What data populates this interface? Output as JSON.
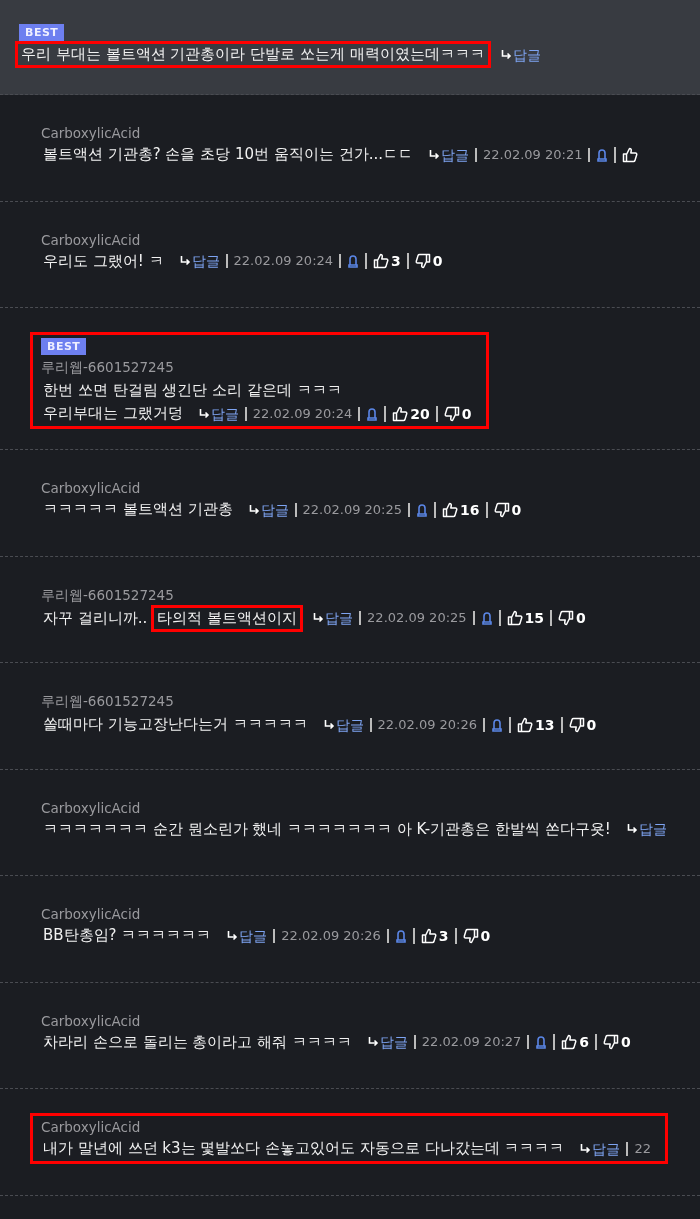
{
  "comments": [
    {
      "kind": "top",
      "badge": "BEST",
      "highlighted": false,
      "lines": [
        [
          {
            "text": "우리 부대는 볼트액션 기관총이라 단발로 쏘는게 매력이였는데ㅋㅋㅋ",
            "highlighted": true
          }
        ]
      ],
      "meta": [
        {
          "kind": "reply",
          "text": "답글"
        }
      ]
    },
    {
      "kind": "reply",
      "author": "CarboxylicAcid",
      "highlighted": false,
      "lines": [
        [
          {
            "text": "볼트액션 기관총? 손을 초당 10번 움직이는 건가...ㄷㄷ",
            "highlighted": false
          }
        ]
      ],
      "meta": [
        {
          "kind": "reply",
          "text": "답글"
        },
        {
          "kind": "date",
          "text": "22.02.09 20:21"
        },
        {
          "kind": "bell"
        },
        {
          "kind": "like"
        }
      ]
    },
    {
      "kind": "reply",
      "author": "CarboxylicAcid",
      "highlighted": false,
      "lines": [
        [
          {
            "text": "우리도 그랬어! ㅋ",
            "highlighted": false
          }
        ]
      ],
      "meta": [
        {
          "kind": "reply",
          "text": "답글"
        },
        {
          "kind": "date",
          "text": "22.02.09 20:24"
        },
        {
          "kind": "bell"
        },
        {
          "kind": "like",
          "count": "3"
        },
        {
          "kind": "dislike",
          "count": "0"
        }
      ]
    },
    {
      "kind": "reply",
      "badge": "BEST",
      "author": "루리웹-6601527245",
      "highlighted": true,
      "lines": [
        [
          {
            "text": "한번 쏘면 탄걸림 생긴단 소리 같은데 ㅋㅋㅋ",
            "highlighted": false
          }
        ],
        [
          {
            "text": "우리부대는 그랬거덩",
            "highlighted": false
          }
        ]
      ],
      "meta": [
        {
          "kind": "reply",
          "text": "답글"
        },
        {
          "kind": "date",
          "text": "22.02.09 20:24"
        },
        {
          "kind": "bell"
        },
        {
          "kind": "like",
          "count": "20"
        },
        {
          "kind": "dislike",
          "count": "0"
        }
      ]
    },
    {
      "kind": "reply",
      "author": "CarboxylicAcid",
      "highlighted": false,
      "lines": [
        [
          {
            "text": "ㅋㅋㅋㅋㅋ 볼트액션 기관총",
            "highlighted": false
          }
        ]
      ],
      "meta": [
        {
          "kind": "reply",
          "text": "답글"
        },
        {
          "kind": "date",
          "text": "22.02.09 20:25"
        },
        {
          "kind": "bell"
        },
        {
          "kind": "like",
          "count": "16"
        },
        {
          "kind": "dislike",
          "count": "0"
        }
      ]
    },
    {
      "kind": "reply",
      "author": "루리웹-6601527245",
      "highlighted": false,
      "lines": [
        [
          {
            "text": "자꾸 걸리니까..",
            "highlighted": false
          },
          {
            "text": "타의적 볼트액션이지",
            "highlighted": true
          }
        ]
      ],
      "meta": [
        {
          "kind": "reply",
          "text": "답글"
        },
        {
          "kind": "date",
          "text": "22.02.09 20:25"
        },
        {
          "kind": "bell"
        },
        {
          "kind": "like",
          "count": "15"
        },
        {
          "kind": "dislike",
          "count": "0"
        }
      ]
    },
    {
      "kind": "reply",
      "author": "루리웹-6601527245",
      "highlighted": false,
      "lines": [
        [
          {
            "text": "쏠때마다 기능고장난다는거 ㅋㅋㅋㅋㅋ",
            "highlighted": false
          }
        ]
      ],
      "meta": [
        {
          "kind": "reply",
          "text": "답글"
        },
        {
          "kind": "date",
          "text": "22.02.09 20:26"
        },
        {
          "kind": "bell"
        },
        {
          "kind": "like",
          "count": "13"
        },
        {
          "kind": "dislike",
          "count": "0"
        }
      ]
    },
    {
      "kind": "reply",
      "author": "CarboxylicAcid",
      "highlighted": false,
      "lines": [
        [
          {
            "text": "ㅋㅋㅋㅋㅋㅋㅋ 순간 뭔소린가 했네 ㅋㅋㅋㅋㅋㅋㅋ 아 K-기관총은 한발씩 쏜다구욧!",
            "highlighted": false
          }
        ]
      ],
      "meta": [
        {
          "kind": "reply",
          "text": "답글"
        }
      ]
    },
    {
      "kind": "reply",
      "author": "CarboxylicAcid",
      "highlighted": false,
      "lines": [
        [
          {
            "text": "BB탄총임? ㅋㅋㅋㅋㅋㅋ",
            "highlighted": false
          }
        ]
      ],
      "meta": [
        {
          "kind": "reply",
          "text": "답글"
        },
        {
          "kind": "date",
          "text": "22.02.09 20:26"
        },
        {
          "kind": "bell"
        },
        {
          "kind": "like",
          "count": "3"
        },
        {
          "kind": "dislike",
          "count": "0"
        }
      ]
    },
    {
      "kind": "reply",
      "author": "CarboxylicAcid",
      "highlighted": false,
      "lines": [
        [
          {
            "text": "차라리 손으로 돌리는 총이라고 해줘 ㅋㅋㅋㅋ",
            "highlighted": false
          }
        ]
      ],
      "meta": [
        {
          "kind": "reply",
          "text": "답글"
        },
        {
          "kind": "date",
          "text": "22.02.09 20:27"
        },
        {
          "kind": "bell"
        },
        {
          "kind": "like",
          "count": "6"
        },
        {
          "kind": "dislike",
          "count": "0"
        }
      ]
    },
    {
      "kind": "reply",
      "author": "CarboxylicAcid",
      "highlighted": true,
      "lines": [
        [
          {
            "text": "내가 말년에 쓰던 k3는 몇발쏘다 손놓고있어도 자동으로 다나갔는데 ㅋㅋㅋㅋ",
            "highlighted": false
          }
        ]
      ],
      "meta": [
        {
          "kind": "reply",
          "text": "답글"
        },
        {
          "kind": "date",
          "text": "22"
        }
      ]
    }
  ]
}
